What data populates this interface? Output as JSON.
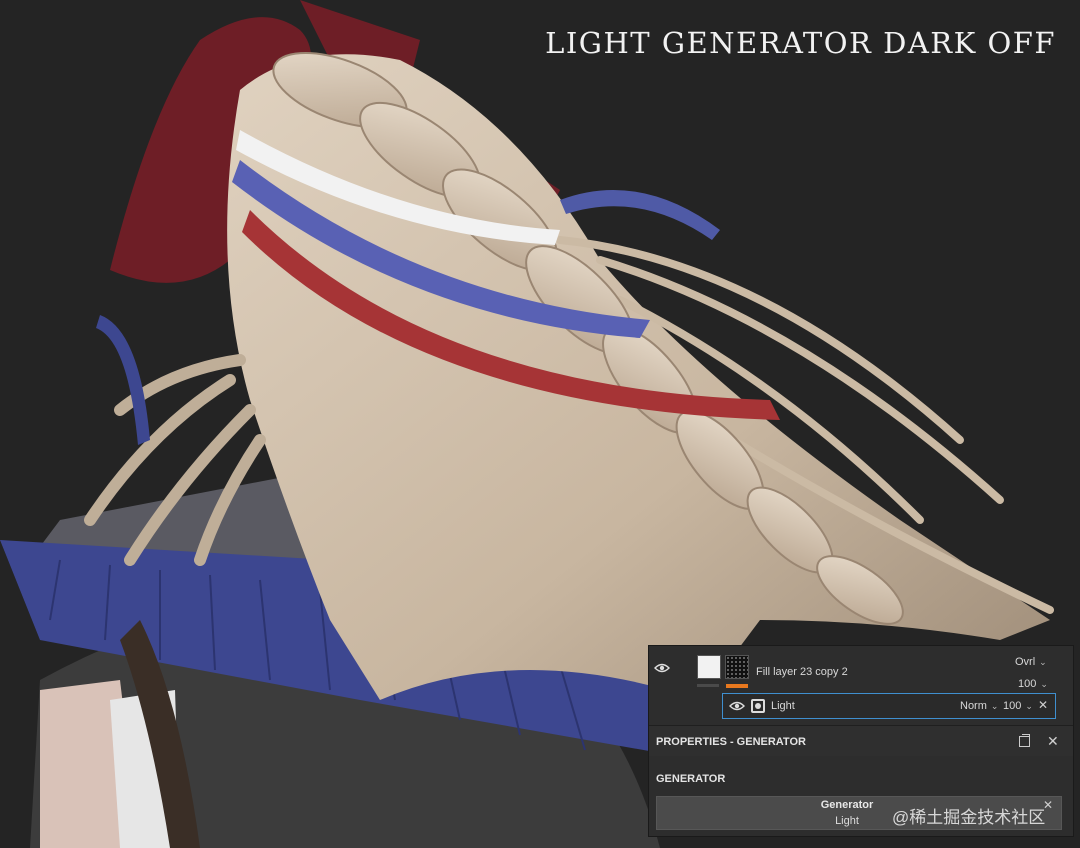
{
  "overlay": {
    "title": "LIGHT GENERATOR DARK OFF"
  },
  "layers": {
    "fill_layer": {
      "name": "Fill layer 23 copy 2",
      "blend_mode": "Ovrl",
      "opacity": "100"
    },
    "effect": {
      "name": "Light",
      "blend_mode": "Norm",
      "opacity": "100"
    }
  },
  "properties": {
    "title": "PROPERTIES - GENERATOR",
    "section": "GENERATOR",
    "generator_name": "Generator",
    "generator_value": "Light"
  },
  "watermark": "@稀土掘金技术社区",
  "colors": {
    "selection": "#3f8fcf",
    "orange_accent": "#e8781e"
  }
}
